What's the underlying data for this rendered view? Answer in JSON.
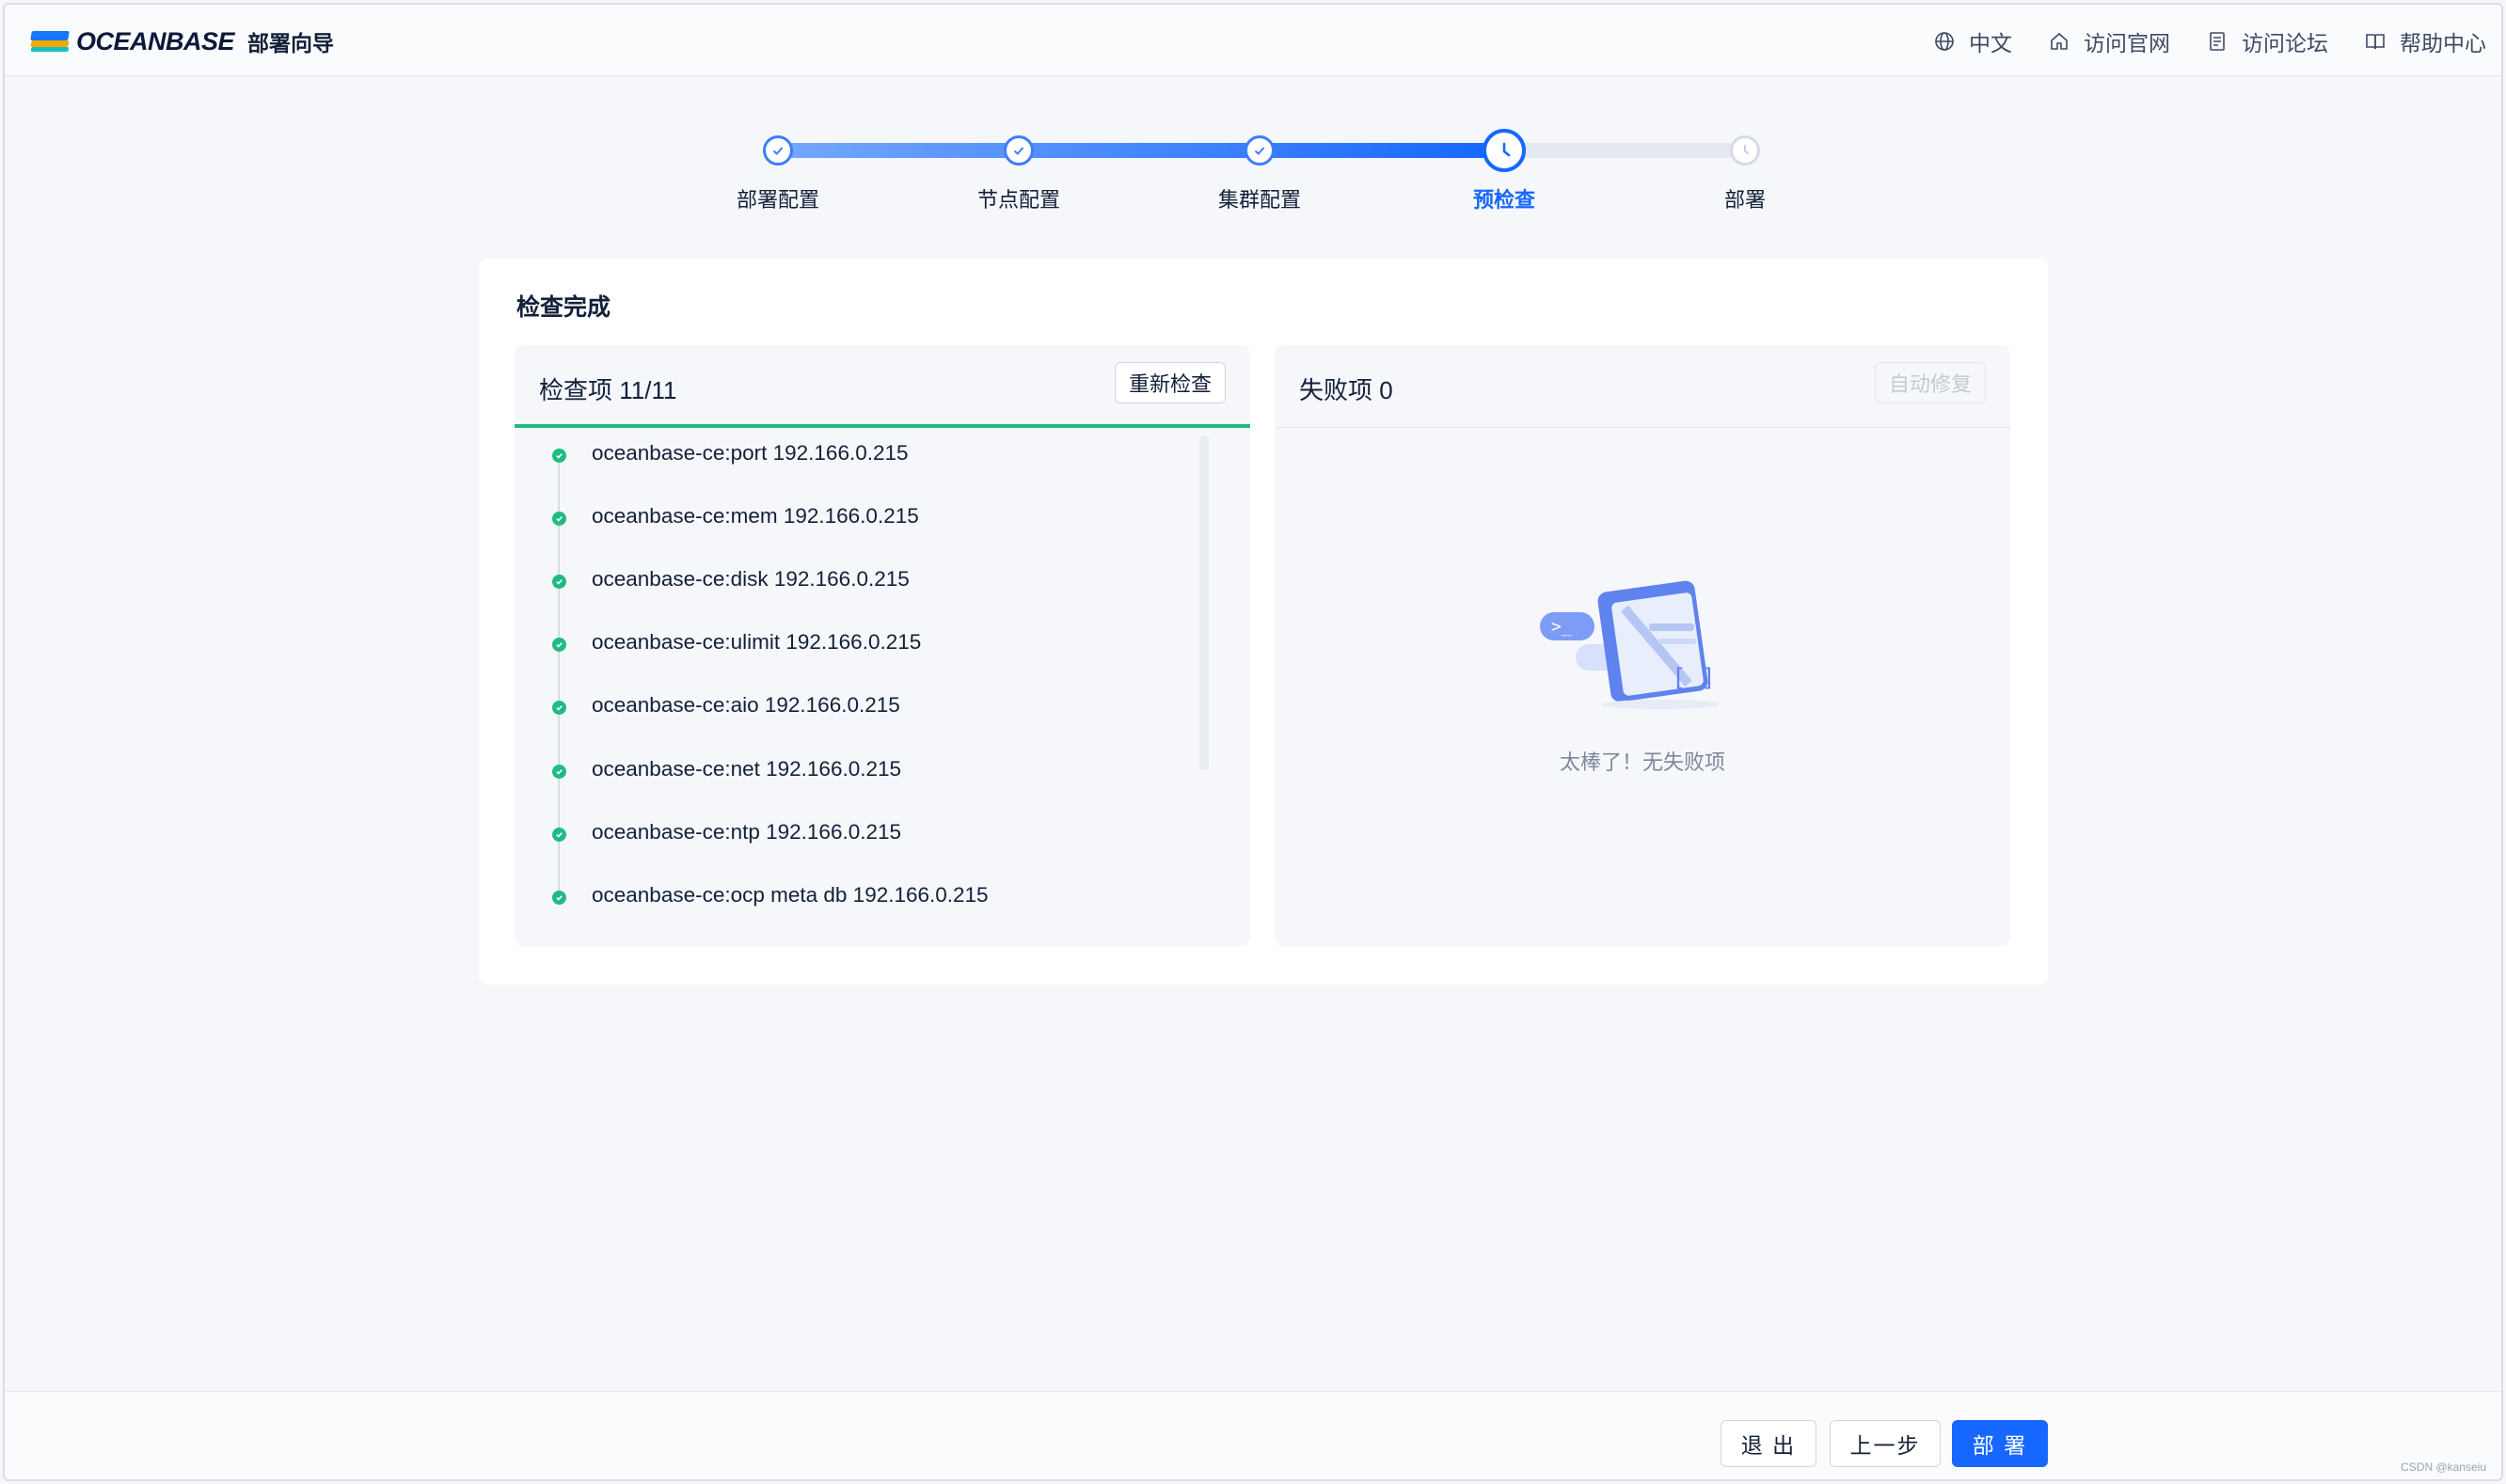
{
  "header": {
    "logo_text": "OCEANBASE",
    "app_title": "部署向导",
    "nav": [
      {
        "label": "中文",
        "icon": "globe-icon"
      },
      {
        "label": "访问官网",
        "icon": "home-icon"
      },
      {
        "label": "访问论坛",
        "icon": "forum-icon"
      },
      {
        "label": "帮助中心",
        "icon": "book-icon"
      }
    ]
  },
  "steps": [
    {
      "label": "部署配置",
      "status": "done"
    },
    {
      "label": "节点配置",
      "status": "done"
    },
    {
      "label": "集群配置",
      "status": "done"
    },
    {
      "label": "预检查",
      "status": "current"
    },
    {
      "label": "部署",
      "status": "pending"
    }
  ],
  "card": {
    "title": "检查完成",
    "left_panel": {
      "title": "检查项 11/11",
      "recheck_button": "重新检查",
      "items": [
        "oceanbase-ce:port 192.166.0.215",
        "oceanbase-ce:mem 192.166.0.215",
        "oceanbase-ce:disk 192.166.0.215",
        "oceanbase-ce:ulimit 192.166.0.215",
        "oceanbase-ce:aio 192.166.0.215",
        "oceanbase-ce:net 192.166.0.215",
        "oceanbase-ce:ntp 192.166.0.215",
        "oceanbase-ce:ocp meta db 192.166.0.215"
      ]
    },
    "right_panel": {
      "title": "失败项 0",
      "auto_fix_button": "自动修复",
      "empty_text": "太棒了！无失败项"
    }
  },
  "footer": {
    "exit_label": "退 出",
    "prev_label": "上一步",
    "deploy_label": "部 署"
  },
  "watermark": "CSDN @kanseiu",
  "colors": {
    "primary": "#1667ff",
    "success": "#1fbb82",
    "background": "#f5f7fb"
  }
}
